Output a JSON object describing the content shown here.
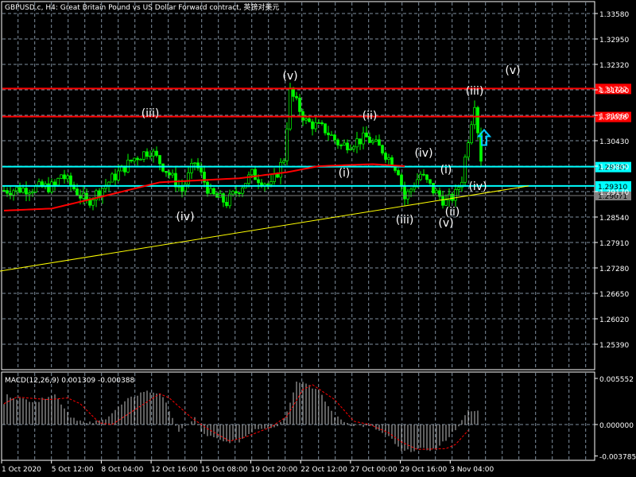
{
  "title": "GBPUSD.c, H4:  Great Britain Pound vs US Dollar Forward contract, 英镑对美元",
  "colors": {
    "bg": "#000000",
    "grid": "#8090a0",
    "candle": "#00ff00",
    "ma": "#ff0000",
    "resistance": "#ff0000",
    "support": "#00ffff",
    "trend": "#ffff00",
    "macd_hist": "#c0c0c0",
    "macd_signal": "#ff0000"
  },
  "chart_data": [
    {
      "type": "candlestick",
      "symbol": "GBPUSD.c",
      "timeframe": "H4",
      "ylim": [
        1.2508,
        1.3395
      ],
      "y_ticks": [
        "1.33580",
        "1.32950",
        "1.32320",
        "1.31690",
        "1.31060",
        "1.30430",
        "1.29800",
        "1.29170",
        "1.28540",
        "1.27910",
        "1.27280",
        "1.26650",
        "1.26020",
        "1.25390"
      ],
      "x_ticks": [
        "1 Oct 2020",
        "5 Oct 12:00",
        "8 Oct 04:00",
        "12 Oct 16:00",
        "15 Oct 08:00",
        "19 Oct 20:00",
        "22 Oct 12:00",
        "27 Oct 00:00",
        "29 Oct 16:00",
        "3 Nov 04:00"
      ],
      "close_anchors": [
        [
          0,
          1.292
        ],
        [
          16,
          1.293
        ],
        [
          18,
          1.296
        ],
        [
          26,
          1.289
        ],
        [
          41,
          1.3
        ],
        [
          46,
          1.302
        ],
        [
          56,
          1.292
        ],
        [
          60,
          1.299
        ],
        [
          65,
          1.291
        ],
        [
          70,
          1.289
        ],
        [
          78,
          1.296
        ],
        [
          84,
          1.293
        ],
        [
          88,
          1.3
        ],
        [
          90,
          1.3165
        ],
        [
          95,
          1.309
        ],
        [
          101,
          1.307
        ],
        [
          106,
          1.303
        ],
        [
          114,
          1.305
        ],
        [
          119,
          1.302
        ],
        [
          124,
          1.297
        ],
        [
          126,
          1.29
        ],
        [
          131,
          1.296
        ],
        [
          135,
          1.292
        ],
        [
          139,
          1.289
        ],
        [
          142,
          1.291
        ],
        [
          144,
          1.295
        ],
        [
          146,
          1.305
        ],
        [
          148,
          1.314
        ],
        [
          150,
          1.3
        ]
      ],
      "ma_anchors": [
        [
          0,
          1.287
        ],
        [
          15,
          1.2875
        ],
        [
          31,
          1.2905
        ],
        [
          49,
          1.294
        ],
        [
          74,
          1.295
        ],
        [
          89,
          1.2965
        ],
        [
          99,
          1.298
        ],
        [
          116,
          1.2985
        ],
        [
          126,
          1.298
        ]
      ],
      "horizontal_levels": [
        {
          "price": "1.31722",
          "kind": "resistance"
        },
        {
          "price": "1.31028",
          "kind": "resistance"
        },
        {
          "price": "1.29787",
          "kind": "support"
        },
        {
          "price": "1.29310",
          "kind": "support"
        }
      ],
      "current_price": "1.29071",
      "trendline": [
        [
          -1.25,
          1.272
        ],
        [
          165,
          1.2931
        ]
      ],
      "wave_labels": [
        {
          "text": "(v)",
          "bar": 90,
          "price": 1.3204
        },
        {
          "text": "(iii)",
          "bar": 46,
          "price": 1.3112
        },
        {
          "text": "(ii)",
          "bar": 115,
          "price": 1.3106
        },
        {
          "text": "(iv)",
          "bar": 132,
          "price": 1.3013
        },
        {
          "text": "(i)",
          "bar": 107,
          "price": 1.2964
        },
        {
          "text": "(i)",
          "bar": 139,
          "price": 1.2972
        },
        {
          "text": "(iv)",
          "bar": 57,
          "price": 1.2856
        },
        {
          "text": "(iii)",
          "bar": 126,
          "price": 1.2848
        },
        {
          "text": "(ii)",
          "bar": 141,
          "price": 1.2868
        },
        {
          "text": "(v)",
          "bar": 139,
          "price": 1.284
        },
        {
          "text": "(iii)",
          "bar": 148,
          "price": 1.3167
        },
        {
          "text": "(iv)",
          "bar": 149,
          "price": 1.2931
        },
        {
          "text": "(v)",
          "bar": 160,
          "price": 1.3218
        }
      ],
      "arrow": {
        "bar": 151,
        "price": 1.305,
        "direction": "up"
      }
    },
    {
      "type": "bar",
      "label": "MACD(12,26,9) 0.001309 -0.000388",
      "y_ticks": [
        "0.005552",
        "0.000000",
        "-0.003785"
      ],
      "ylim": [
        -0.003785,
        0.005552
      ],
      "hist_anchors": [
        [
          0,
          0.0025
        ],
        [
          1,
          0.0035
        ],
        [
          6,
          0.003
        ],
        [
          11,
          0.0028
        ],
        [
          14,
          0.0035
        ],
        [
          16,
          0.0036
        ],
        [
          21,
          0.001
        ],
        [
          26,
          0.0001
        ],
        [
          31,
          0.0005
        ],
        [
          39,
          0.003
        ],
        [
          44,
          0.004
        ],
        [
          49,
          0.0038
        ],
        [
          52,
          0.0018
        ],
        [
          55,
          -0.001
        ],
        [
          60,
          0.0008
        ],
        [
          62,
          -0.001
        ],
        [
          69,
          -0.0021
        ],
        [
          74,
          -0.002
        ],
        [
          79,
          -0.0005
        ],
        [
          86,
          -0.0002
        ],
        [
          89,
          0.0015
        ],
        [
          92,
          0.0053
        ],
        [
          95,
          0.005
        ],
        [
          99,
          0.004
        ],
        [
          104,
          0.001
        ],
        [
          109,
          0.0
        ],
        [
          116,
          -0.0003
        ],
        [
          122,
          -0.0018
        ],
        [
          125,
          -0.0033
        ],
        [
          130,
          -0.003
        ],
        [
          136,
          -0.003
        ],
        [
          141,
          -0.001
        ],
        [
          144,
          0.0004
        ],
        [
          146,
          0.0016
        ],
        [
          149,
          0.0016
        ]
      ],
      "signal_anchors": [
        [
          0,
          0.0025
        ],
        [
          4,
          0.0033
        ],
        [
          14,
          0.003
        ],
        [
          20,
          0.0032
        ],
        [
          24,
          0.0025
        ],
        [
          30,
          0.0002
        ],
        [
          34,
          0.0
        ],
        [
          40,
          0.0015
        ],
        [
          49,
          0.0037
        ],
        [
          52,
          0.0032
        ],
        [
          59,
          0.0008
        ],
        [
          64,
          -0.0005
        ],
        [
          71,
          -0.002
        ],
        [
          76,
          -0.0015
        ],
        [
          84,
          -0.0003
        ],
        [
          89,
          0.001
        ],
        [
          94,
          0.0042
        ],
        [
          97,
          0.0048
        ],
        [
          104,
          0.003
        ],
        [
          110,
          0.0004
        ],
        [
          115,
          0.0
        ],
        [
          121,
          -0.001
        ],
        [
          125,
          -0.0021
        ],
        [
          130,
          -0.003
        ],
        [
          139,
          -0.0029
        ],
        [
          142,
          -0.0024
        ],
        [
          146,
          -0.0007
        ]
      ]
    }
  ]
}
